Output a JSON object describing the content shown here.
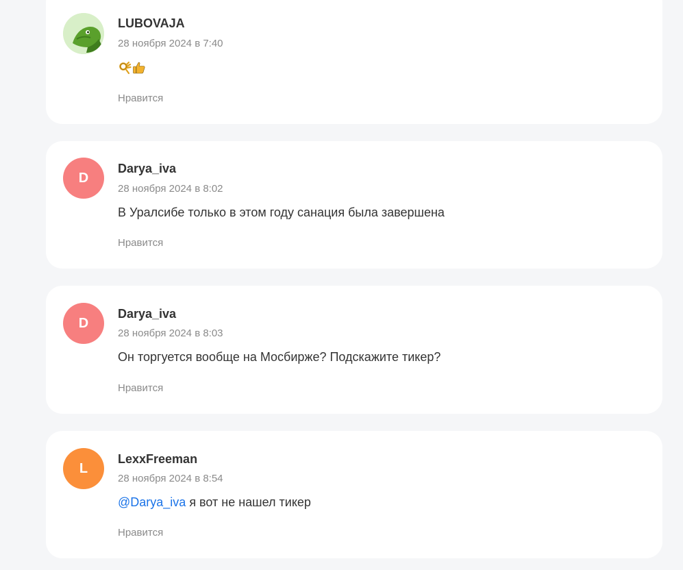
{
  "comments": [
    {
      "author": "LUBOVAJA",
      "date": "28 ноября 2024 в 7:40",
      "emojis": [
        "ok-hand",
        "thumbs-up"
      ],
      "like_label": "Нравится"
    },
    {
      "author": "Darya_iva",
      "avatar_letter": "D",
      "date": "28 ноября 2024 в 8:02",
      "text": "В Уралсибе только в этом году санация была завершена",
      "like_label": "Нравится"
    },
    {
      "author": "Darya_iva",
      "avatar_letter": "D",
      "date": "28 ноября 2024 в 8:03",
      "text": "Он торгуется вообще на Мосбирже? Подскажите тикер?",
      "like_label": "Нравится"
    },
    {
      "author": "LexxFreeman",
      "avatar_letter": "L",
      "date": "28 ноября 2024 в 8:54",
      "mention": "@Darya_iva",
      "text": " я вот не нашел тикер",
      "like_label": "Нравится"
    }
  ],
  "colors": {
    "page_bg": "#f5f6f8",
    "avatar_d": "#f77f7f",
    "avatar_l": "#fb8f3a",
    "mention": "#1a73e8",
    "muted_text": "#8a8a8a"
  }
}
